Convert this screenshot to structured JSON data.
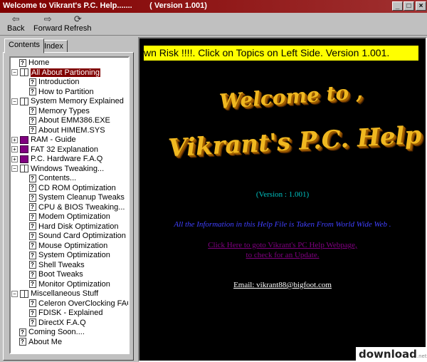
{
  "window": {
    "title": "Welcome to Vikrant's P.C. Help.......        ( Version 1.001)",
    "controls": {
      "minimize": "_",
      "maximize": "□",
      "close": "×"
    }
  },
  "toolbar": {
    "back": {
      "label": "Back",
      "icon": "⇦"
    },
    "forward": {
      "label": "Forward",
      "icon": "⇨"
    },
    "refresh": {
      "label": "Refresh",
      "icon": "⟳"
    }
  },
  "tabs": [
    {
      "label": "Contents",
      "active": true
    },
    {
      "label": "Index",
      "active": false
    }
  ],
  "tree": [
    {
      "label": "Home",
      "type": "doc",
      "level": 1
    },
    {
      "label": "All About Partioning",
      "type": "open",
      "level": 0,
      "selected": true
    },
    {
      "label": "Introduction",
      "type": "doc",
      "level": 2
    },
    {
      "label": "How to Partition",
      "type": "doc",
      "level": 2
    },
    {
      "label": "System Memory Explained",
      "type": "open",
      "level": 0
    },
    {
      "label": "Memory Types",
      "type": "doc",
      "level": 2
    },
    {
      "label": "About EMM386.EXE",
      "type": "doc",
      "level": 2
    },
    {
      "label": "About HIMEM.SYS",
      "type": "doc",
      "level": 2
    },
    {
      "label": "RAM - Guide",
      "type": "closed",
      "level": 0
    },
    {
      "label": "FAT 32 Explanation",
      "type": "closed",
      "level": 0
    },
    {
      "label": "P.C. Hardware F.A.Q",
      "type": "closed",
      "level": 0
    },
    {
      "label": "Windows Tweaking...",
      "type": "open",
      "level": 0
    },
    {
      "label": "Contents...",
      "type": "doc",
      "level": 2
    },
    {
      "label": "CD ROM Optimization",
      "type": "doc",
      "level": 2
    },
    {
      "label": "System Cleanup Tweaks",
      "type": "doc",
      "level": 2
    },
    {
      "label": "CPU & BIOS Tweaking...",
      "type": "doc",
      "level": 2
    },
    {
      "label": "Modem Optimization",
      "type": "doc",
      "level": 2
    },
    {
      "label": "Hard Disk Optimization",
      "type": "doc",
      "level": 2
    },
    {
      "label": "Sound Card Optimization",
      "type": "doc",
      "level": 2
    },
    {
      "label": "Mouse Optimization",
      "type": "doc",
      "level": 2
    },
    {
      "label": "System Optimization",
      "type": "doc",
      "level": 2
    },
    {
      "label": "Shell Tweaks",
      "type": "doc",
      "level": 2
    },
    {
      "label": "Boot Tweaks",
      "type": "doc",
      "level": 2
    },
    {
      "label": "Monitor Optimization",
      "type": "doc",
      "level": 2
    },
    {
      "label": "Miscellaneous Stuff",
      "type": "open",
      "level": 0
    },
    {
      "label": "Celeron OverClocking FAQ",
      "type": "doc",
      "level": 2
    },
    {
      "label": "FDISK - Explained",
      "type": "doc",
      "level": 2
    },
    {
      "label": "DirectX F.A.Q",
      "type": "doc",
      "level": 2
    },
    {
      "label": "Coming Soon....",
      "type": "doc",
      "level": 1
    },
    {
      "label": "About Me",
      "type": "doc",
      "level": 1
    }
  ],
  "content": {
    "marquee": "wn Risk !!!!.    Click on Topics on Left Side.   Version 1.001.",
    "welcome": "Welcome to ,",
    "app_name": "Vikrant's P.C. Help",
    "version": "(Version : 1.001)",
    "info": "All the Information in this Help File is Taken From World Wide Web .",
    "link_line1": "Click Here to goto Vikrant's PC Help Webpage,",
    "link_line2": "to check for an Update.",
    "email": "Email: vikrant88@bigfoot.com"
  },
  "watermark": {
    "text": "download",
    "suffix": ".net.pl"
  },
  "colors": {
    "titlebar": "#800000",
    "marquee_bg": "#ffff00",
    "gold_text": "#f0b820",
    "content_bg": "#000000"
  }
}
